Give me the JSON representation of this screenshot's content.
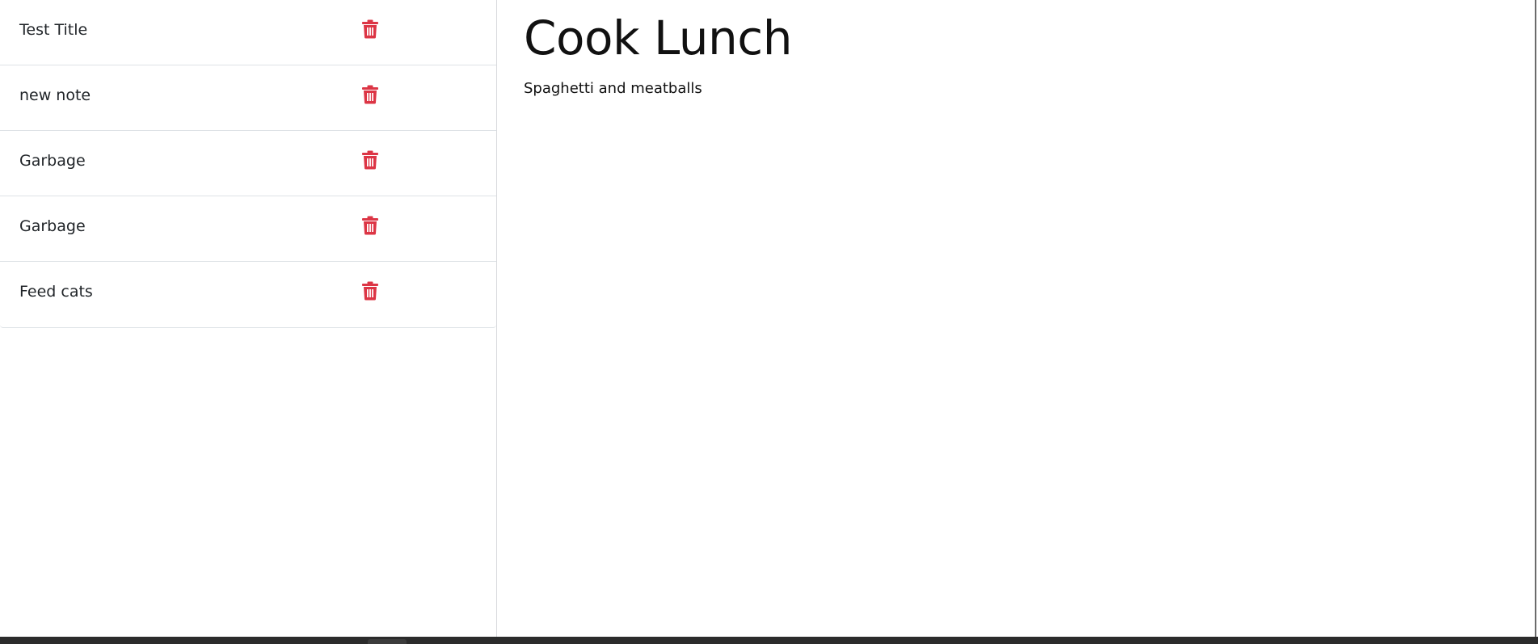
{
  "notes": [
    {
      "title": "Test Title"
    },
    {
      "title": "new note"
    },
    {
      "title": "Garbage"
    },
    {
      "title": "Garbage"
    },
    {
      "title": "Feed cats"
    }
  ],
  "delete_icon": "trash-icon",
  "colors": {
    "delete": "#dc3545",
    "divider": "#dee2e6",
    "text": "#212529"
  },
  "selected_note": {
    "title": "Cook Lunch",
    "body": "Spaghetti and meatballs"
  }
}
